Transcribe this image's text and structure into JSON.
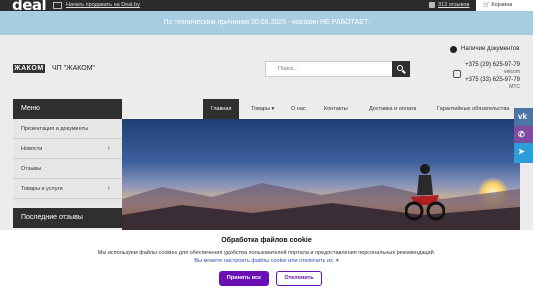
{
  "topbar": {
    "logo": "deal",
    "sell_link": "Начать продавать на Deal.by",
    "reviews_link": "313 отзывов",
    "cart": "Корзина"
  },
  "notice": "По техническим причинам 30.08.2025 - магазин НЕ РАБОТАЕТ.",
  "header": {
    "logo_text": "ЖАКОМ",
    "company": "ЧП \"ЖАКОМ\"",
    "search_placeholder": "Поиск...",
    "docs_label": "Наличие документов",
    "phones": [
      {
        "number": "+375 (29) 625-97-79",
        "operator": "velcom"
      },
      {
        "number": "+375 (33) 625-97-79",
        "operator": "МТС"
      }
    ]
  },
  "sidebar": {
    "menu_title": "Меню",
    "items": [
      {
        "label": "Презентация и документы",
        "chevron": ""
      },
      {
        "label": "Новости",
        "chevron": "›"
      },
      {
        "label": "Отзывы",
        "chevron": ""
      },
      {
        "label": "Товары и услуги",
        "chevron": "›"
      }
    ],
    "recent_title": "Последние отзывы"
  },
  "nav": {
    "items": [
      {
        "label": "Главная",
        "active": true
      },
      {
        "label": "Товары ▾",
        "active": false
      },
      {
        "label": "О нас",
        "active": false
      },
      {
        "label": "Контакты",
        "active": false
      },
      {
        "label": "Доставка и оплата",
        "active": false
      },
      {
        "label": "Гарантийные обязательства",
        "active": false
      }
    ]
  },
  "social": [
    {
      "name": "vk-icon",
      "glyph": "vk",
      "color": "#4c75a3"
    },
    {
      "name": "viber-icon",
      "glyph": "✆",
      "color": "#7f4da0"
    },
    {
      "name": "telegram-icon",
      "glyph": "➤",
      "color": "#2e9ed8"
    }
  ],
  "cookie": {
    "title": "Обработка файлов cookie",
    "text": "Мы используем файлы cookies для обеспечения удобства пользователей портала и предоставления персональных рекомендаций.",
    "link": "Вы можете настроить файлы cookie или отключить их. ▾",
    "accept": "Принять все",
    "reject": "Отклонить"
  },
  "colors": {
    "accent": "#6a0fb6",
    "dark": "#2f2f2f",
    "notice_bg": "#a8cde2"
  }
}
